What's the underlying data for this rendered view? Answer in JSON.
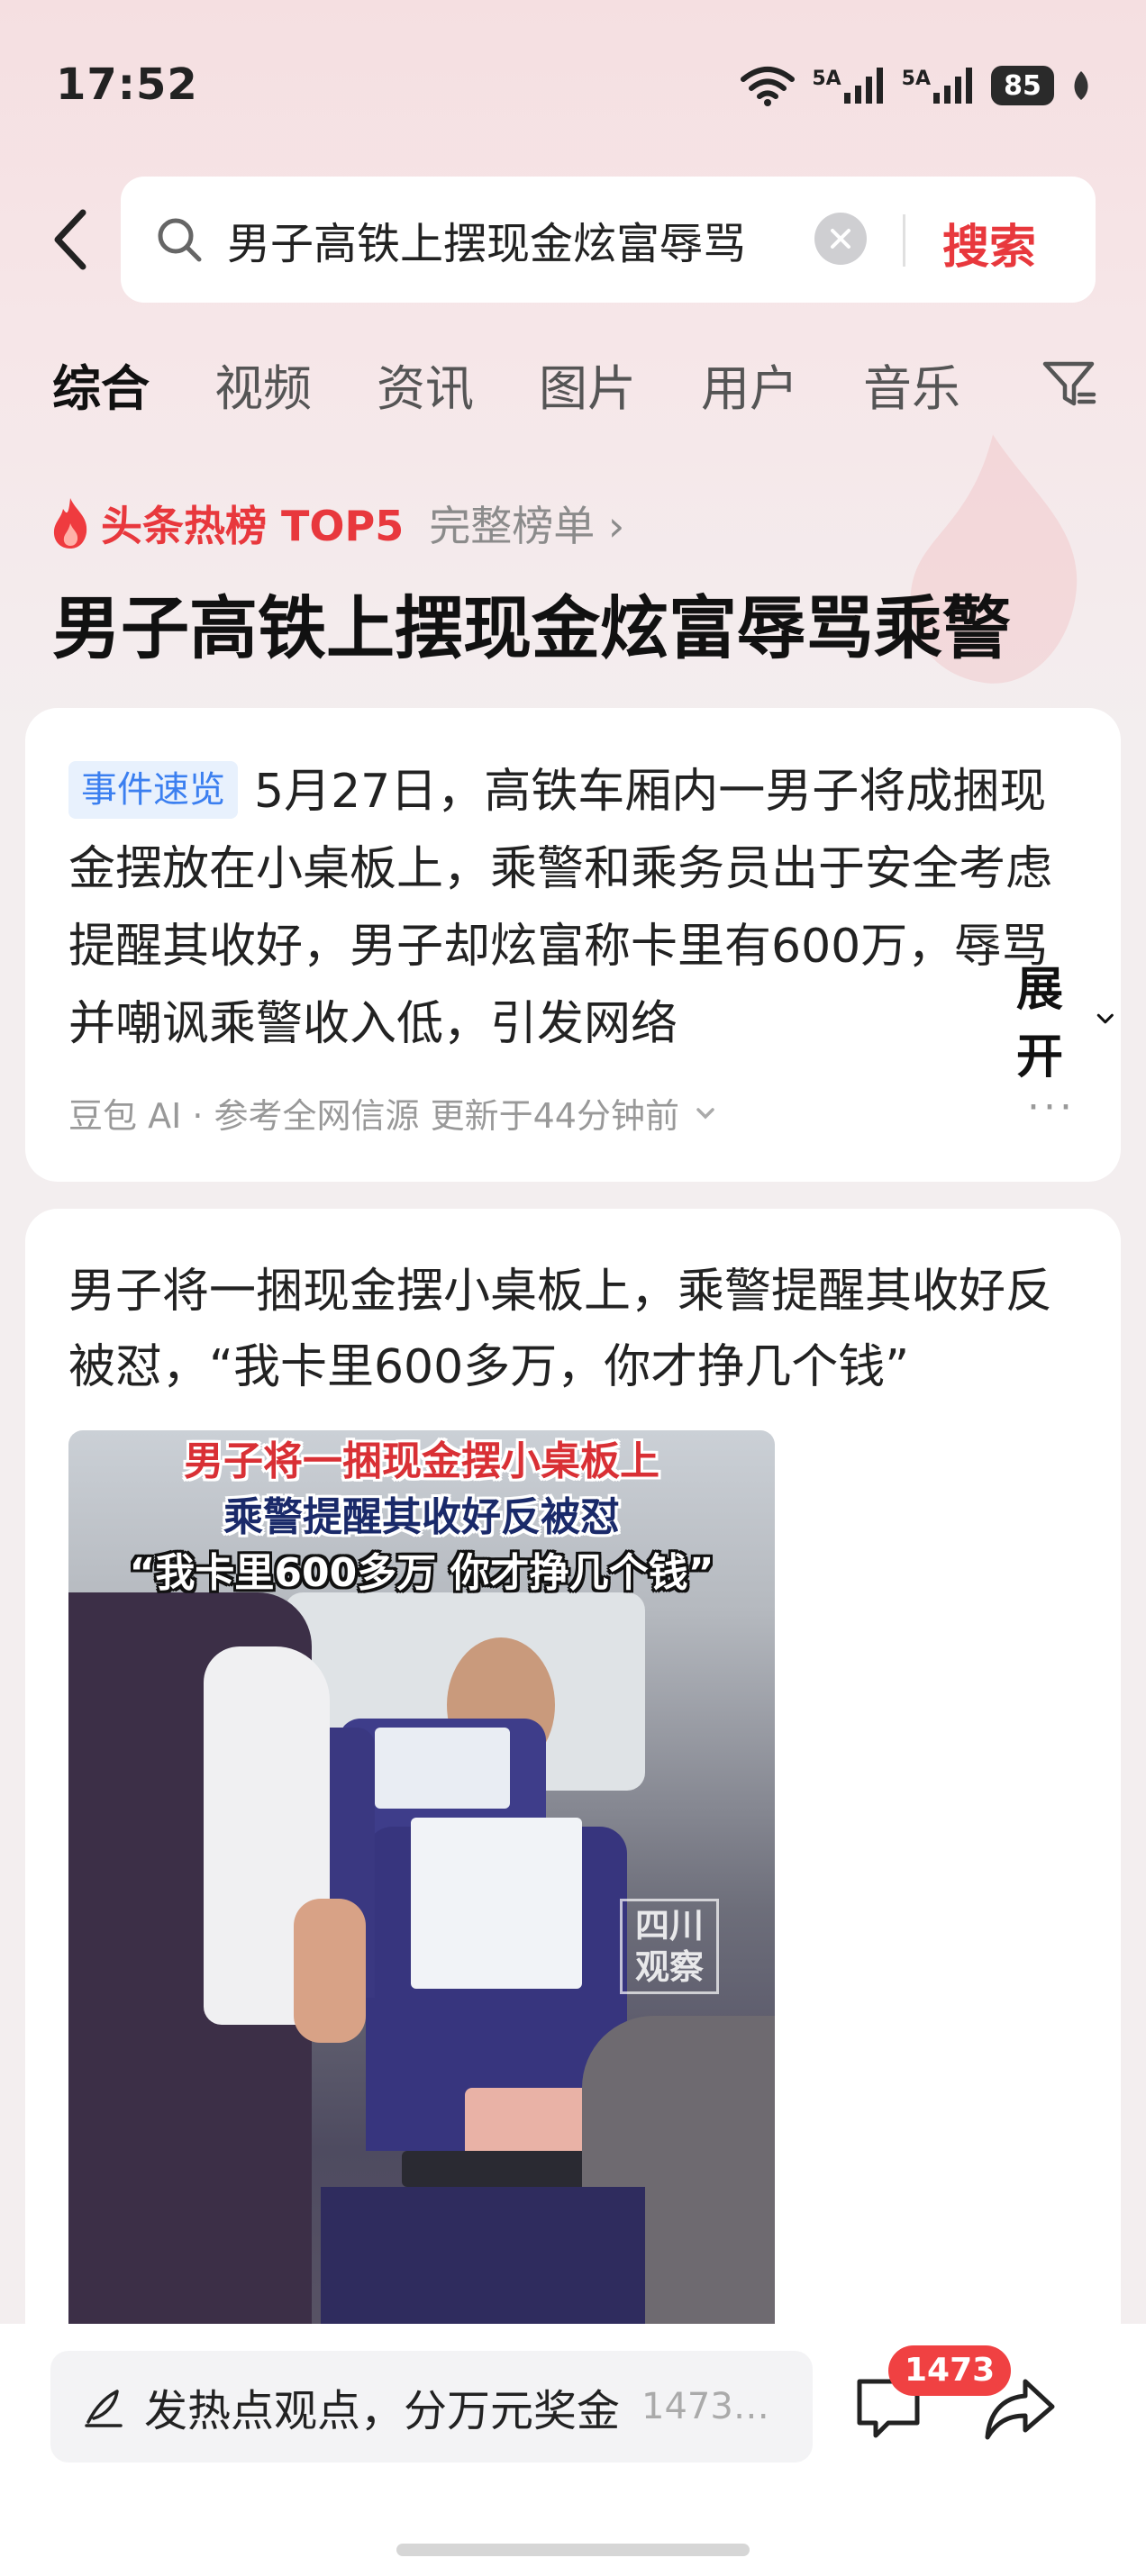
{
  "status_bar": {
    "time": "17:52",
    "signal1": "5A",
    "signal2": "5A",
    "battery": "85"
  },
  "search": {
    "query": "男子高铁上摆现金炫富辱骂",
    "button_label": "搜索"
  },
  "tabs": [
    {
      "label": "综合",
      "active": true
    },
    {
      "label": "视频"
    },
    {
      "label": "资讯"
    },
    {
      "label": "图片"
    },
    {
      "label": "用户"
    },
    {
      "label": "音乐"
    }
  ],
  "hot": {
    "label": "头条热榜 TOP5",
    "full_list": "完整榜单 ›",
    "headline": "男子高铁上摆现金炫富辱骂乘警"
  },
  "summary_card": {
    "badge": "事件速览",
    "text": "5月27日，高铁车厢内一男子将成捆现金摆放在小桌板上，乘警和乘务员出于安全考虑提醒其收好，男子却炫富称卡里有600万，辱骂并嘲讽乘警收入低，引发网络",
    "expand_label": "展开",
    "meta": "豆包 AI · 参考全网信源 更新于44分钟前",
    "more": "···"
  },
  "article_card": {
    "title": "男子将一捆现金摆小桌板上，乘警提醒其收好反被怼，“我卡里600多万，你才挣几个钱”",
    "video": {
      "caption_line1": "男子将一捆现金摆小桌板上",
      "caption_line2": "乘警提醒其收好反被怼",
      "caption_line3": "“我卡里600多万 你才挣几个钱”",
      "watermark": "四川观察"
    }
  },
  "bottom_bar": {
    "comment_prompt": "发热点观点，分万元奖金",
    "comment_hint": "1473…",
    "comment_count": "1473"
  },
  "colors": {
    "accent": "#e8383d",
    "badge_blue": "#3b7ff0"
  }
}
